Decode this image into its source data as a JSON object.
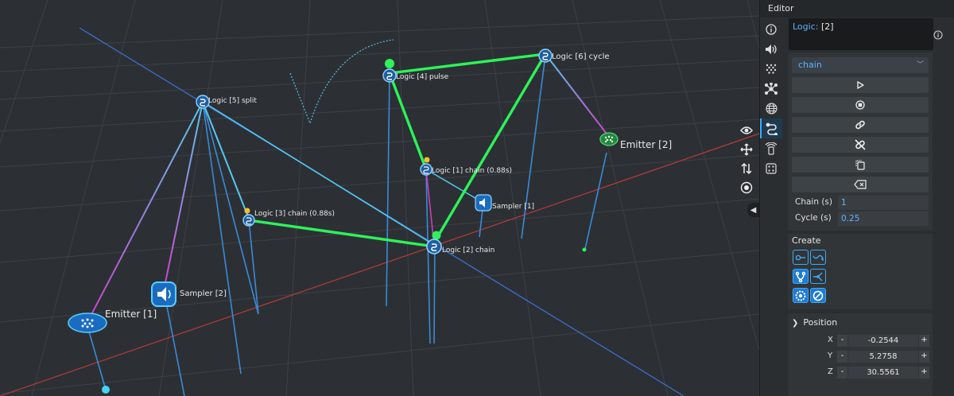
{
  "editor": {
    "title": "Editor",
    "info": {
      "key": "Logic:",
      "value": "[2]"
    },
    "mode_dropdown": "chain",
    "chain_field": {
      "label": "Chain (s)",
      "value": "1"
    },
    "cycle_field": {
      "label": "Cycle (s)",
      "value": "0.25"
    },
    "create_title": "Create",
    "position": {
      "title": "Position",
      "x_label": "X",
      "x_value": "-0.2544",
      "y_label": "Y",
      "y_value": "5.2758",
      "z_label": "Z",
      "z_value": "30.5561",
      "minus": "-",
      "plus": "+"
    },
    "side_tabs": [
      "info-icon",
      "speaker-icon",
      "particles-icon",
      "network-icon",
      "sphere-icon",
      "logic-icon",
      "motion-icon",
      "grid-icon"
    ]
  },
  "scene": {
    "nodes": {
      "logic5": "Logic [5] split",
      "logic4": "Logic [4] pulse",
      "logic6": "Logic [6] cycle",
      "logic1": "Logic [1] chain (0.88s)",
      "logic3": "Logic [3] chain (0.88s)",
      "logic2": "Logic [2] chain",
      "sampler1": "Sampler [1]",
      "sampler2": "Sampler [2]",
      "emitter1": "Emitter [1]",
      "emitter2": "Emitter [2]"
    }
  },
  "colors": {
    "accent": "#3fa9f5",
    "link_green": "#2df25a",
    "link_cyan": "#57c8f0",
    "link_magenta": "#d040c8",
    "axis_red": "#b83a3a",
    "axis_blue": "#3b6fd0"
  }
}
